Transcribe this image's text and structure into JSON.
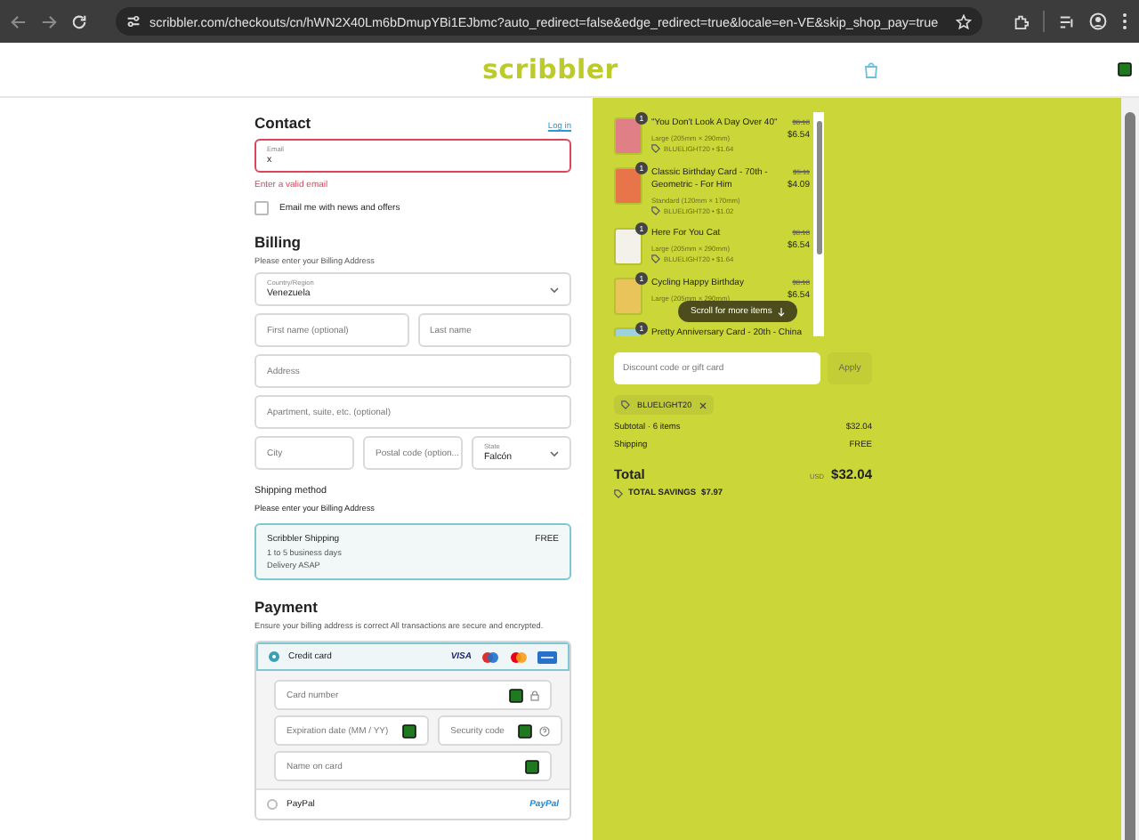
{
  "browser": {
    "url": "scribbler.com/checkouts/cn/hWN2X40Lm6bDmupYBi1EJbmc?auto_redirect=false&edge_redirect=true&locale=en-VE&skip_shop_pay=true"
  },
  "header": {
    "logo": "scribbler"
  },
  "contact": {
    "title": "Contact",
    "login_link": "Log in",
    "email": {
      "label": "Email",
      "value": "x",
      "error": "Enter a valid email"
    },
    "newsletter": {
      "label": "Email me with news and offers",
      "checked": false
    }
  },
  "billing": {
    "title": "Billing",
    "subtitle": "Please enter your Billing Address",
    "rows": [
      [
        {
          "kind": "select",
          "label": "Country/Region",
          "value": "Venezuela"
        }
      ],
      [
        {
          "kind": "input",
          "placeholder": "First name (optional)"
        },
        {
          "kind": "input",
          "placeholder": "Last name"
        }
      ],
      [
        {
          "kind": "input",
          "placeholder": "Address"
        }
      ],
      [
        {
          "kind": "input",
          "placeholder": "Apartment, suite, etc. (optional)"
        }
      ],
      [
        {
          "kind": "input",
          "placeholder": "City"
        },
        {
          "kind": "input",
          "placeholder": "Postal code (option..."
        },
        {
          "kind": "select",
          "label": "State",
          "value": "Falcón"
        }
      ]
    ]
  },
  "shipping": {
    "title": "Shipping method",
    "note": "Please enter your Billing Address",
    "option": {
      "name": "Scribbler Shipping",
      "price": "FREE",
      "lines": [
        "1 to 5 business days",
        "Delivery ASAP"
      ],
      "selected": true
    }
  },
  "payment": {
    "title": "Payment",
    "note": "Ensure your billing address is correct All transactions are secure and encrypted.",
    "methods": [
      {
        "kind": "card",
        "label": "Credit card",
        "selected": true,
        "brand": "VISA",
        "fields": [
          [
            {
              "placeholder": "Card number"
            }
          ],
          [
            {
              "placeholder": "Expiration date (MM / YY)"
            },
            {
              "placeholder": "Security code"
            }
          ],
          [
            {
              "placeholder": "Name on card"
            }
          ]
        ]
      },
      {
        "kind": "paypal",
        "label": "PayPal",
        "selected": false,
        "brand": "PayPal"
      }
    ]
  },
  "order": {
    "items": [
      {
        "title": "\"You Don't Look A Day Over 40\"",
        "variant": "Large (205mm × 290mm)",
        "discount": "BLUELIGHT20 • $1.64",
        "old_price": "$8.18",
        "price": "$6.54",
        "quantity": "1",
        "color": "#e07f86"
      },
      {
        "title": "Classic Birthday Card - 70th - Geometric - For Him",
        "variant": "Standard (120mm × 170mm)",
        "discount": "BLUELIGHT20 • $1.02",
        "old_price": "$5.11",
        "price": "$4.09",
        "quantity": "1",
        "color": "#e8744a"
      },
      {
        "title": "Here For You Cat",
        "variant": "Large (205mm × 290mm)",
        "discount": "BLUELIGHT20 • $1.64",
        "old_price": "$8.18",
        "price": "$6.54",
        "quantity": "1",
        "color": "#f4f1ea"
      },
      {
        "title": "Cycling Happy Birthday",
        "variant": "Large (205mm × 290mm)",
        "old_price": "$8.18",
        "price": "$6.54",
        "quantity": "1",
        "color": "#e9c45a"
      },
      {
        "title": "Pretty Anniversary Card - 20th - China",
        "quantity": "1",
        "color": "#9fd3dc"
      }
    ],
    "scroll_hint": "Scroll for more items",
    "discount_placeholder": "Discount code or gift card",
    "apply": "Apply",
    "code": "BLUELIGHT20",
    "subtotal_label": "Subtotal · 6 items",
    "subtotal": "$32.04",
    "shipping_label": "Shipping",
    "shipping": "FREE",
    "total_label": "Total",
    "currency": "USD",
    "total": "$32.04",
    "savings_label": "TOTAL SAVINGS",
    "savings": "$7.97"
  }
}
